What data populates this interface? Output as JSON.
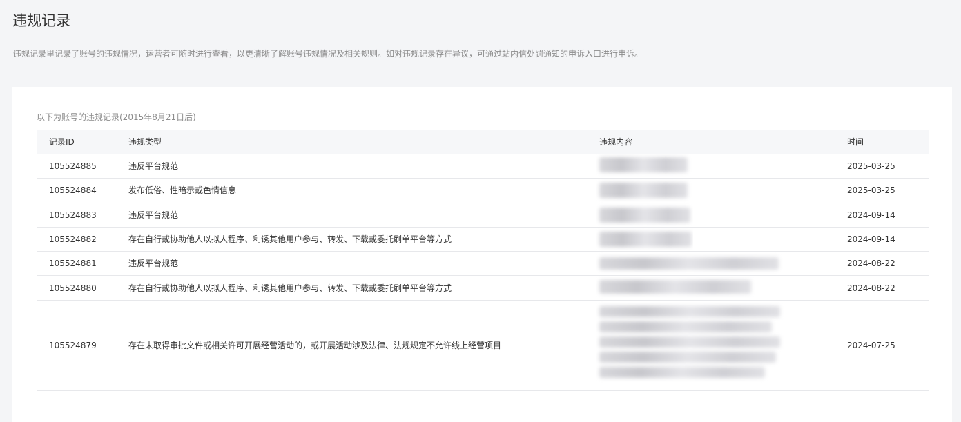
{
  "page": {
    "title": "违规记录",
    "description": "违规记录里记录了账号的违规情况，运营者可随时进行查看，以更清晰了解账号违规情况及相关规则。如对违规记录存在异议，可通过站内信处罚通知的申诉入口进行申诉。"
  },
  "table": {
    "caption": "以下为账号的违规记录(2015年8月21日后)",
    "columns": {
      "id": "记录ID",
      "type": "违规类型",
      "content": "违规内容",
      "time": "时间"
    },
    "rows": [
      {
        "id": "105524885",
        "type": "违反平台规范",
        "time": "2025-03-25"
      },
      {
        "id": "105524884",
        "type": "发布低俗、性暗示或色情信息",
        "time": "2025-03-25"
      },
      {
        "id": "105524883",
        "type": "违反平台规范",
        "time": "2024-09-14"
      },
      {
        "id": "105524882",
        "type": "存在自行或协助他人以拟人程序、利诱其他用户参与、转发、下载或委托刷单平台等方式",
        "time": "2024-09-14"
      },
      {
        "id": "105524881",
        "type": "违反平台规范",
        "time": "2024-08-22"
      },
      {
        "id": "105524880",
        "type": "存在自行或协助他人以拟人程序、利诱其他用户参与、转发、下载或委托刷单平台等方式",
        "time": "2024-08-22"
      },
      {
        "id": "105524879",
        "type": "存在未取得审批文件或相关许可开展经营活动的，或开展活动涉及法律、法规规定不允许线上经营项目",
        "time": "2024-07-25"
      }
    ]
  },
  "colors": {
    "background": "#f4f5f7",
    "card": "#ffffff",
    "header_row": "#f6f7f9",
    "border": "#e7e8eb",
    "text": "#353535",
    "muted_text": "#8c8c8c"
  }
}
